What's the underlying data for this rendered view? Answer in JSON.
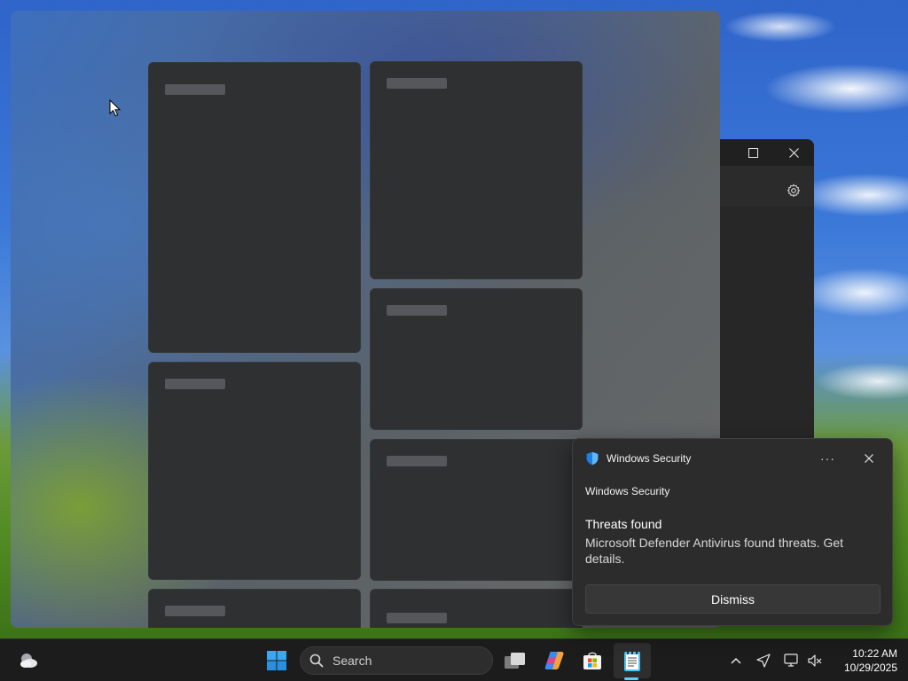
{
  "toast": {
    "app_name": "Windows Security",
    "attribution": "Windows Security",
    "title": "Threats found",
    "body": "Microsoft Defender Antivirus found threats. Get details.",
    "dismiss_label": "Dismiss",
    "more_label": "···"
  },
  "taskbar": {
    "search_label": "Search",
    "time": "10:22 AM",
    "date": "10/29/2025",
    "pinned_apps": [
      "start",
      "search",
      "task-view",
      "copilot",
      "microsoft-store",
      "notepad"
    ]
  },
  "accent_color": "#60cdff"
}
